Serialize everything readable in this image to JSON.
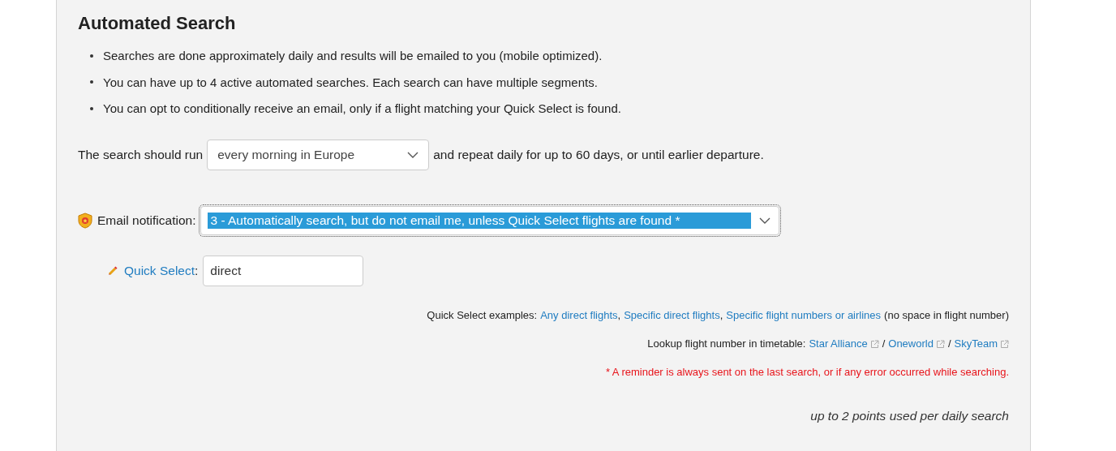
{
  "title": "Automated Search",
  "bullets": [
    "Searches are done approximately daily and results will be emailed to you (mobile optimized).",
    "You can have up to 4 active automated searches. Each search can have multiple segments.",
    "You can opt to conditionally receive an email, only if a flight matching your Quick Select is found."
  ],
  "schedule": {
    "prefix": "The search should run",
    "value": "every morning in Europe",
    "suffix": "and repeat daily for up to 60 days, or until earlier departure."
  },
  "email_notification": {
    "label": "Email notification:",
    "value": "3 - Automatically search, but do not email me, unless Quick Select flights are found *",
    "focused": true
  },
  "quick_select": {
    "label": "Quick Select",
    "colon": ":",
    "value": "direct"
  },
  "examples": {
    "prefix": "Quick Select examples:",
    "links": [
      "Any direct flights",
      "Specific direct flights",
      "Specific flight numbers or airlines"
    ],
    "separator": ",",
    "suffix": "(no space in flight number)"
  },
  "timetable": {
    "prefix": "Lookup flight number in timetable:",
    "links": [
      "Star Alliance",
      "Oneworld",
      "SkyTeam"
    ],
    "separator": "/"
  },
  "footnote": "* A reminder is always sent on the last search, or if any error occurred while searching.",
  "points_note": "up to 2 points used per daily search"
}
